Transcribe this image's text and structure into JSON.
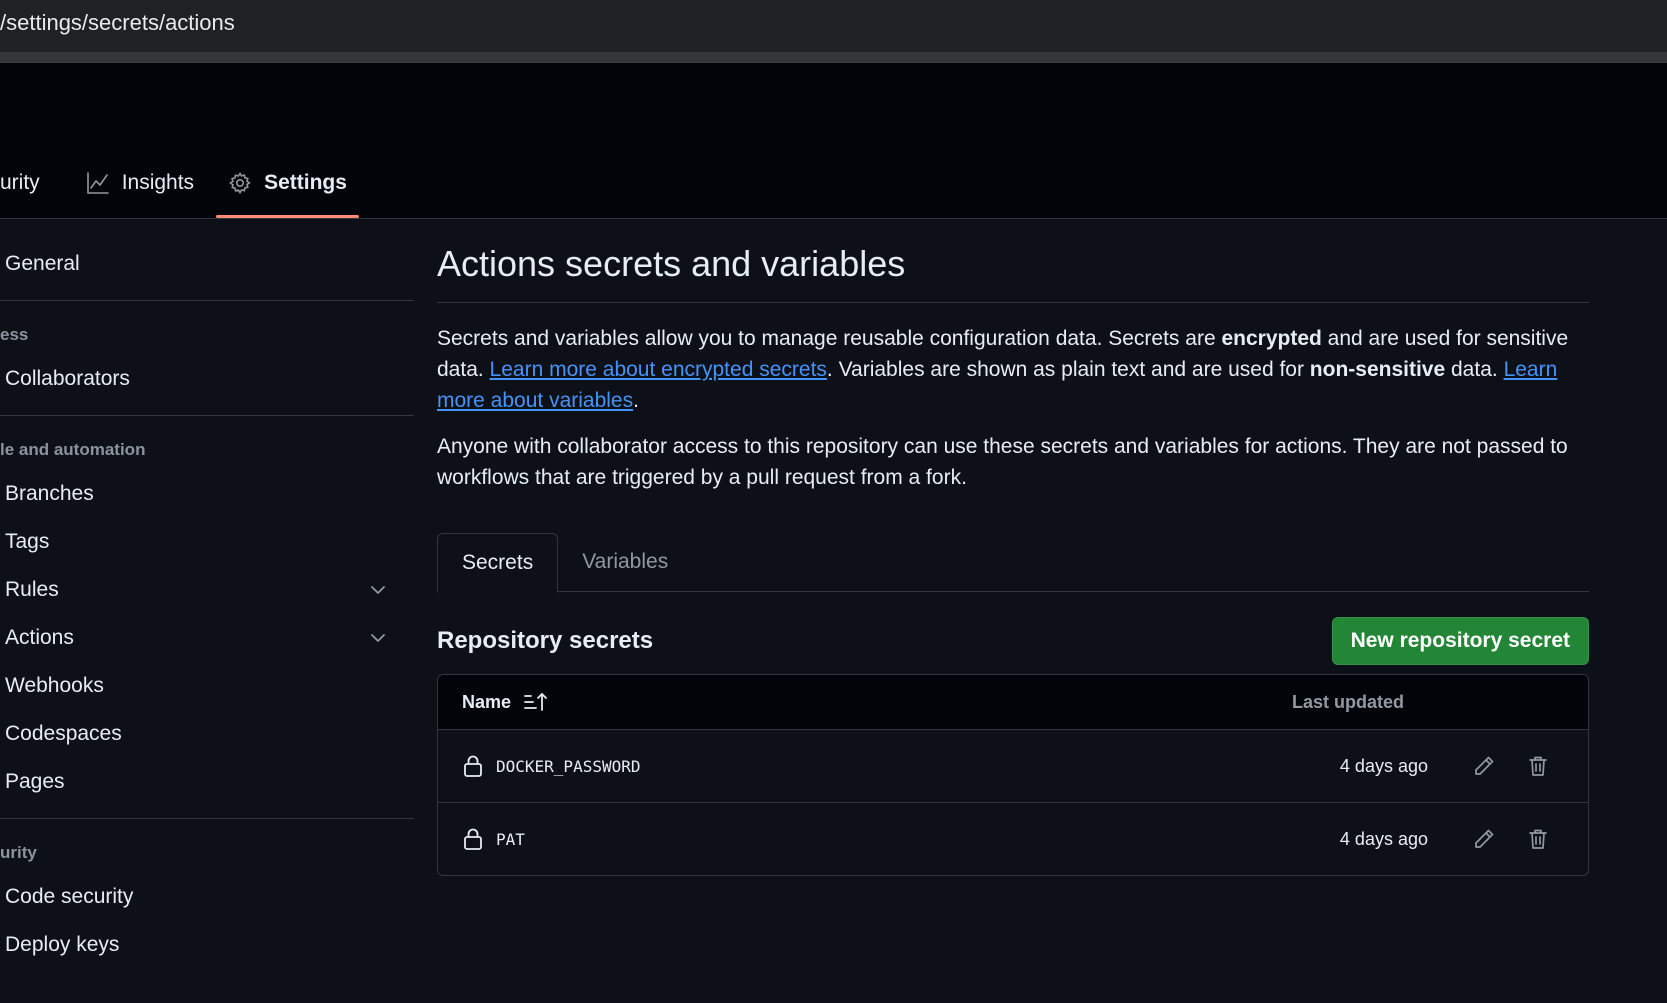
{
  "browser": {
    "url": "/settings/secrets/actions"
  },
  "repo_nav": {
    "items": [
      {
        "label": "urity",
        "icon": "shield-icon"
      },
      {
        "label": "Insights",
        "icon": "graph-icon"
      },
      {
        "label": "Settings",
        "icon": "gear-icon",
        "active": true
      }
    ]
  },
  "sidebar": {
    "general": "General",
    "access_heading": "ess",
    "collaborators": "Collaborators",
    "code_heading": "le and automation",
    "branches": "Branches",
    "tags": "Tags",
    "rules": "Rules",
    "actions": "Actions",
    "webhooks": "Webhooks",
    "codespaces": "Codespaces",
    "pages": "Pages",
    "security_heading": "urity",
    "code_security": "Code security",
    "deploy_keys": "Deploy keys"
  },
  "main": {
    "title": "Actions secrets and variables",
    "desc1": {
      "p1": "Secrets and variables allow you to manage reusable configuration data. Secrets are ",
      "b1": "encrypted",
      "p2": " and are used for sensitive data. ",
      "link1": "Learn more about encrypted secrets",
      "p3": ". Variables are shown as plain text and are used for ",
      "b2": "non-sensitive",
      "p4": " data. ",
      "link2": "Learn more about variables",
      "p5": "."
    },
    "desc2": "Anyone with collaborator access to this repository can use these secrets and variables for actions. They are not passed to workflows that are triggered by a pull request from a fork.",
    "tabs": {
      "secrets": "Secrets",
      "variables": "Variables"
    },
    "section_title": "Repository secrets",
    "new_button": "New repository secret",
    "table": {
      "col_name": "Name",
      "col_updated": "Last updated",
      "rows": [
        {
          "name": "DOCKER_PASSWORD",
          "updated": "4 days ago"
        },
        {
          "name": "PAT",
          "updated": "4 days ago"
        }
      ]
    }
  },
  "colors": {
    "page_bg": "#0d1117",
    "header_bg": "#010409",
    "accent_underline": "#fd8c73",
    "link": "#4493f8",
    "primary_button": "#238636"
  }
}
